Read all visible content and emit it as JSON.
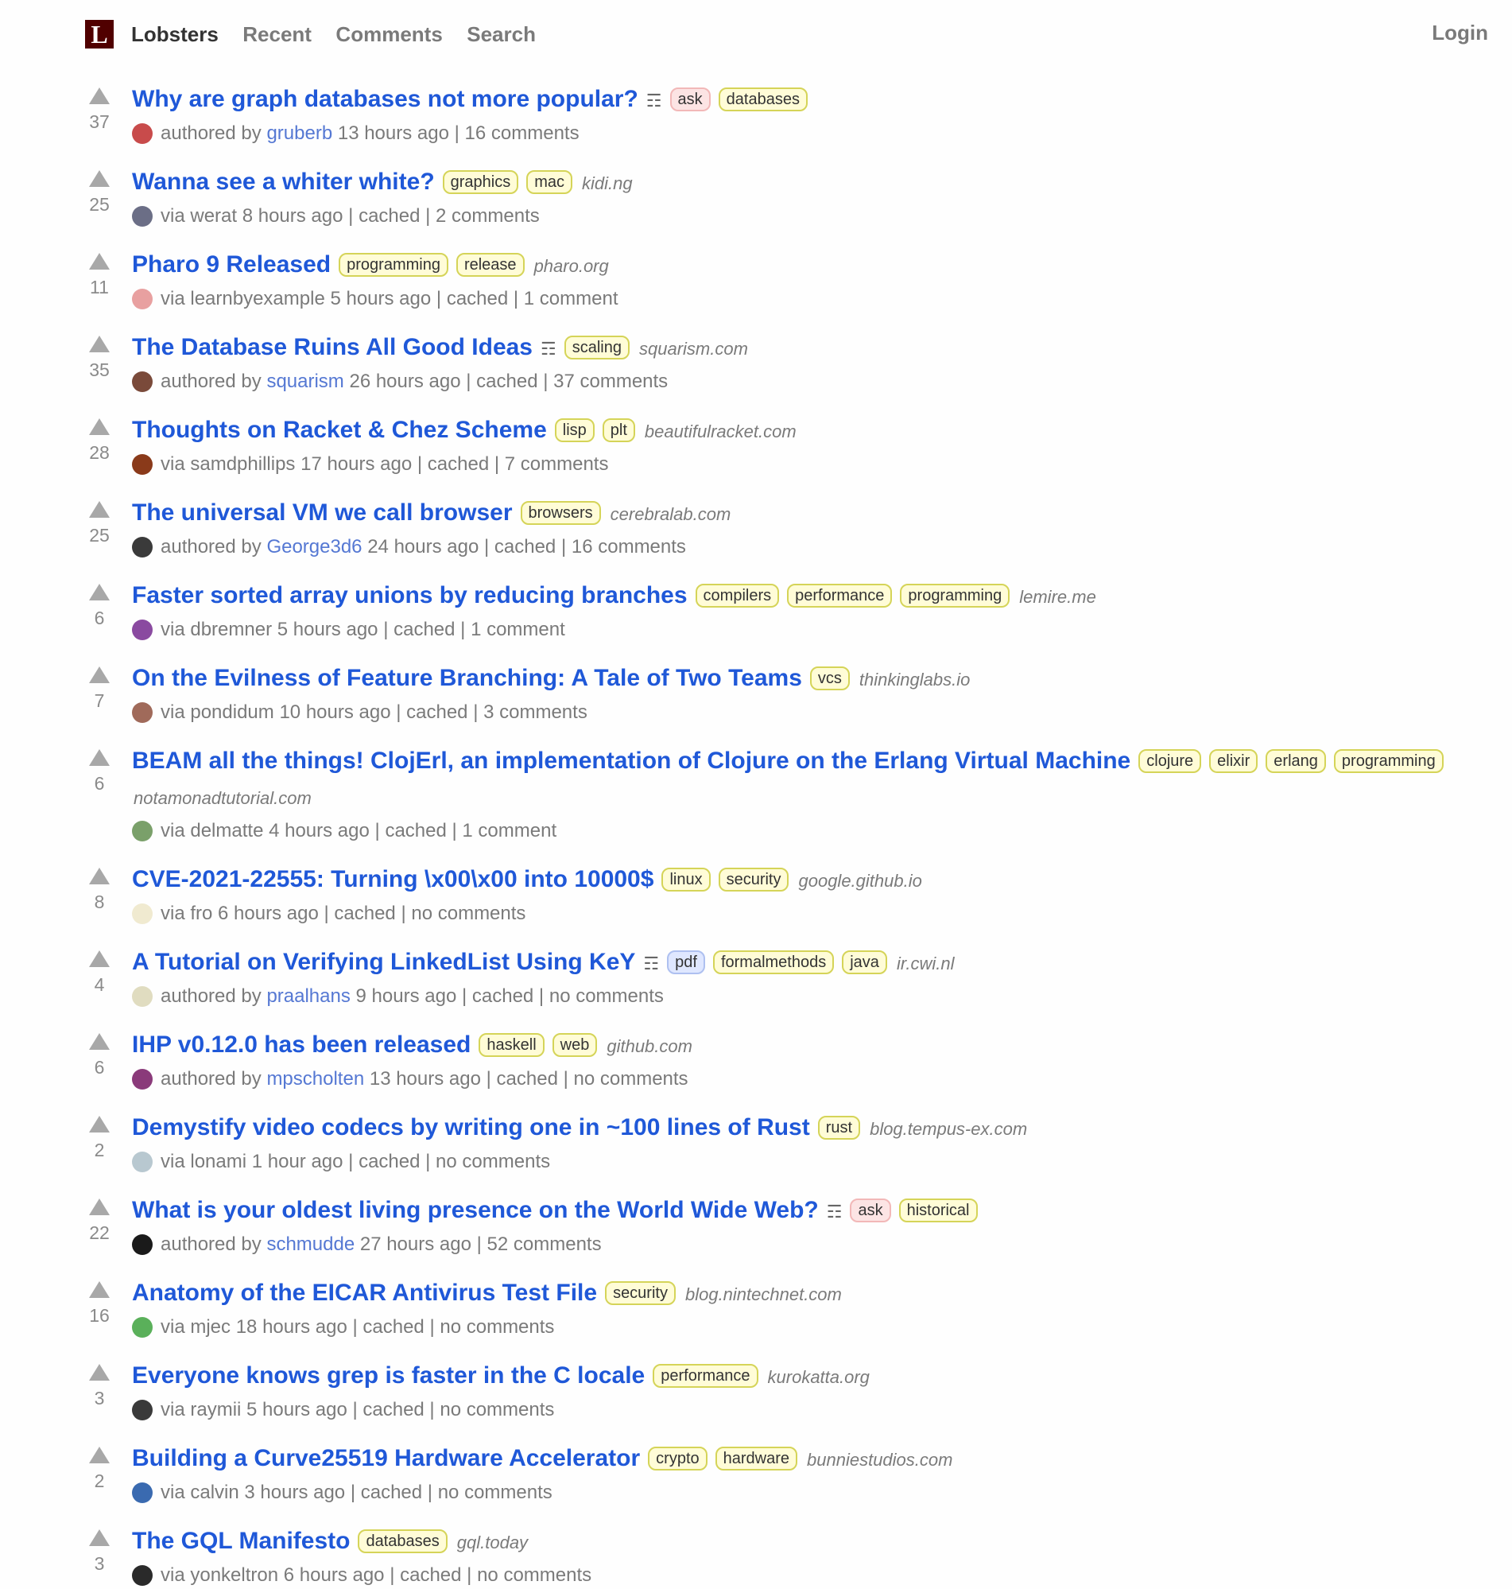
{
  "header": {
    "logo": "L",
    "nav": [
      "Lobsters",
      "Recent",
      "Comments",
      "Search"
    ],
    "login": "Login"
  },
  "stories": [
    {
      "score": "37",
      "title": "Why are graph databases not more popular?",
      "desc": true,
      "tags": [
        {
          "t": "ask",
          "k": "ask"
        },
        {
          "t": "databases",
          "k": ""
        }
      ],
      "domain": "",
      "by": "authored by",
      "user": "gruberb",
      "user_link": true,
      "time": "13 hours ago",
      "cached": false,
      "comments": "16 comments",
      "avatar": "#c84b4b"
    },
    {
      "score": "25",
      "title": "Wanna see a whiter white?",
      "desc": false,
      "tags": [
        {
          "t": "graphics",
          "k": ""
        },
        {
          "t": "mac",
          "k": ""
        }
      ],
      "domain": "kidi.ng",
      "by": "via",
      "user": "werat",
      "user_link": false,
      "time": "8 hours ago",
      "cached": true,
      "comments": "2 comments",
      "avatar": "#6b6e86"
    },
    {
      "score": "11",
      "title": "Pharo 9 Released",
      "desc": false,
      "tags": [
        {
          "t": "programming",
          "k": ""
        },
        {
          "t": "release",
          "k": ""
        }
      ],
      "domain": "pharo.org",
      "by": "via",
      "user": "learnbyexample",
      "user_link": false,
      "time": "5 hours ago",
      "cached": true,
      "comments": "1 comment",
      "avatar": "#e8a0a0"
    },
    {
      "score": "35",
      "title": "The Database Ruins All Good Ideas",
      "desc": true,
      "tags": [
        {
          "t": "scaling",
          "k": ""
        }
      ],
      "domain": "squarism.com",
      "by": "authored by",
      "user": "squarism",
      "user_link": true,
      "time": "26 hours ago",
      "cached": true,
      "comments": "37 comments",
      "avatar": "#7a4a3a"
    },
    {
      "score": "28",
      "title": "Thoughts on Racket & Chez Scheme",
      "desc": false,
      "tags": [
        {
          "t": "lisp",
          "k": ""
        },
        {
          "t": "plt",
          "k": ""
        }
      ],
      "domain": "beautifulracket.com",
      "by": "via",
      "user": "samdphillips",
      "user_link": false,
      "time": "17 hours ago",
      "cached": true,
      "comments": "7 comments",
      "avatar": "#8a3a1a"
    },
    {
      "score": "25",
      "title": "The universal VM we call browser",
      "desc": false,
      "tags": [
        {
          "t": "browsers",
          "k": ""
        }
      ],
      "domain": "cerebralab.com",
      "by": "authored by",
      "user": "George3d6",
      "user_link": true,
      "time": "24 hours ago",
      "cached": true,
      "comments": "16 comments",
      "avatar": "#3a3a3a"
    },
    {
      "score": "6",
      "title": "Faster sorted array unions by reducing branches",
      "desc": false,
      "tags": [
        {
          "t": "compilers",
          "k": ""
        },
        {
          "t": "performance",
          "k": ""
        },
        {
          "t": "programming",
          "k": ""
        }
      ],
      "domain": "lemire.me",
      "by": "via",
      "user": "dbremner",
      "user_link": false,
      "time": "5 hours ago",
      "cached": true,
      "comments": "1 comment",
      "avatar": "#8a4aa0"
    },
    {
      "score": "7",
      "title": "On the Evilness of Feature Branching: A Tale of Two Teams",
      "desc": false,
      "tags": [
        {
          "t": "vcs",
          "k": ""
        }
      ],
      "domain": "thinkinglabs.io",
      "by": "via",
      "user": "pondidum",
      "user_link": false,
      "time": "10 hours ago",
      "cached": true,
      "comments": "3 comments",
      "avatar": "#a06a5a"
    },
    {
      "score": "6",
      "title": "BEAM all the things! ClojErl, an implementation of Clojure on the Erlang Virtual Machine",
      "desc": false,
      "tags": [
        {
          "t": "clojure",
          "k": ""
        },
        {
          "t": "elixir",
          "k": ""
        },
        {
          "t": "erlang",
          "k": ""
        },
        {
          "t": "programming",
          "k": ""
        }
      ],
      "domain": "notamonadtutorial.com",
      "by": "via",
      "user": "delmatte",
      "user_link": false,
      "time": "4 hours ago",
      "cached": true,
      "comments": "1 comment",
      "avatar": "#7aa06a"
    },
    {
      "score": "8",
      "title": "CVE-2021-22555: Turning \\x00\\x00 into 10000$",
      "desc": false,
      "tags": [
        {
          "t": "linux",
          "k": ""
        },
        {
          "t": "security",
          "k": ""
        }
      ],
      "domain": "google.github.io",
      "by": "via",
      "user": "fro",
      "user_link": false,
      "time": "6 hours ago",
      "cached": true,
      "comments": "no comments",
      "avatar": "#f0ead0"
    },
    {
      "score": "4",
      "title": "A Tutorial on Verifying LinkedList Using KeY",
      "desc": true,
      "tags": [
        {
          "t": "pdf",
          "k": "media"
        },
        {
          "t": "formalmethods",
          "k": ""
        },
        {
          "t": "java",
          "k": ""
        }
      ],
      "domain": "ir.cwi.nl",
      "by": "authored by",
      "user": "praalhans",
      "user_link": true,
      "time": "9 hours ago",
      "cached": true,
      "comments": "no comments",
      "avatar": "#e0dcc0"
    },
    {
      "score": "6",
      "title": "IHP v0.12.0 has been released",
      "desc": false,
      "tags": [
        {
          "t": "haskell",
          "k": ""
        },
        {
          "t": "web",
          "k": ""
        }
      ],
      "domain": "github.com",
      "by": "authored by",
      "user": "mpscholten",
      "user_link": true,
      "time": "13 hours ago",
      "cached": true,
      "comments": "no comments",
      "avatar": "#8a3a7a"
    },
    {
      "score": "2",
      "title": "Demystify video codecs by writing one in ~100 lines of Rust",
      "desc": false,
      "tags": [
        {
          "t": "rust",
          "k": ""
        }
      ],
      "domain": "blog.tempus-ex.com",
      "by": "via",
      "user": "lonami",
      "user_link": false,
      "time": "1 hour ago",
      "cached": true,
      "comments": "no comments",
      "avatar": "#b8c8d0"
    },
    {
      "score": "22",
      "title": "What is your oldest living presence on the World Wide Web?",
      "desc": true,
      "tags": [
        {
          "t": "ask",
          "k": "ask"
        },
        {
          "t": "historical",
          "k": ""
        }
      ],
      "domain": "",
      "by": "authored by",
      "user": "schmudde",
      "user_link": true,
      "time": "27 hours ago",
      "cached": false,
      "comments": "52 comments",
      "avatar": "#1a1a1a"
    },
    {
      "score": "16",
      "title": "Anatomy of the EICAR Antivirus Test File",
      "desc": false,
      "tags": [
        {
          "t": "security",
          "k": ""
        }
      ],
      "domain": "blog.nintechnet.com",
      "by": "via",
      "user": "mjec",
      "user_link": false,
      "time": "18 hours ago",
      "cached": true,
      "comments": "no comments",
      "avatar": "#5ab05a"
    },
    {
      "score": "3",
      "title": "Everyone knows grep is faster in the C locale",
      "desc": false,
      "tags": [
        {
          "t": "performance",
          "k": ""
        }
      ],
      "domain": "kurokatta.org",
      "by": "via",
      "user": "raymii",
      "user_link": false,
      "time": "5 hours ago",
      "cached": true,
      "comments": "no comments",
      "avatar": "#3a3a3a"
    },
    {
      "score": "2",
      "title": "Building a Curve25519 Hardware Accelerator",
      "desc": false,
      "tags": [
        {
          "t": "crypto",
          "k": ""
        },
        {
          "t": "hardware",
          "k": ""
        }
      ],
      "domain": "bunniestudios.com",
      "by": "via",
      "user": "calvin",
      "user_link": false,
      "time": "3 hours ago",
      "cached": true,
      "comments": "no comments",
      "avatar": "#3a6ab0"
    },
    {
      "score": "3",
      "title": "The GQL Manifesto",
      "desc": false,
      "tags": [
        {
          "t": "databases",
          "k": ""
        }
      ],
      "domain": "gql.today",
      "by": "via",
      "user": "yonkeltron",
      "user_link": false,
      "time": "6 hours ago",
      "cached": true,
      "comments": "no comments",
      "avatar": "#2a2a2a"
    }
  ],
  "labels": {
    "cached": "cached",
    "sep": "|",
    "desc_icon": "☶"
  }
}
